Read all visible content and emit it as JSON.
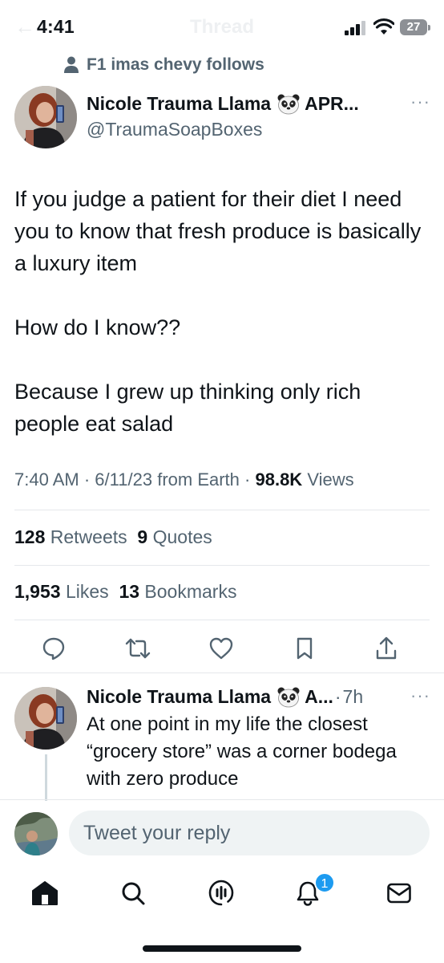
{
  "status_bar": {
    "time": "4:41",
    "battery": "27",
    "ghost_back": "←",
    "ghost_title": "Thread"
  },
  "social_context": {
    "text": "F1 imas chevy follows",
    "icon": "person-icon"
  },
  "main_tweet": {
    "author_name": "Nicole Trauma Llama",
    "author_name_suffix": "APR...",
    "handle": "@TraumaSoapBoxes",
    "emoji": "panda-emoji",
    "paragraphs": [
      "If you judge a patient for their diet I need you to know that fresh produce is basically a luxury item",
      "How do I know??",
      "Because I grew up thinking only rich people eat salad"
    ],
    "time": "7:40 AM",
    "date": "6/11/23",
    "source": "from Earth",
    "views_count": "98.8K",
    "views_label": "Views",
    "retweets_count": "128",
    "retweets_label": "Retweets",
    "quotes_count": "9",
    "quotes_label": "Quotes",
    "likes_count": "1,953",
    "likes_label": "Likes",
    "bookmarks_count": "13",
    "bookmarks_label": "Bookmarks"
  },
  "actions": [
    "reply-icon",
    "retweet-icon",
    "like-icon",
    "bookmark-icon",
    "share-icon"
  ],
  "reply_tweet": {
    "author_name": "Nicole Trauma Llama",
    "author_name_suffix": "A...",
    "separator": "·",
    "time": "7h",
    "text": "At one point in my life the closest “grocery store” was a corner bodega with zero produce"
  },
  "compose": {
    "placeholder": "Tweet your reply"
  },
  "tab_bar": {
    "items": [
      "home-icon",
      "search-icon",
      "spaces-icon",
      "notifications-icon",
      "messages-icon"
    ],
    "notification_badge": "1"
  },
  "colors": {
    "text": "#0f1419",
    "secondary": "#536471",
    "accent": "#1d9bf0",
    "divider": "#e5e8eb"
  }
}
